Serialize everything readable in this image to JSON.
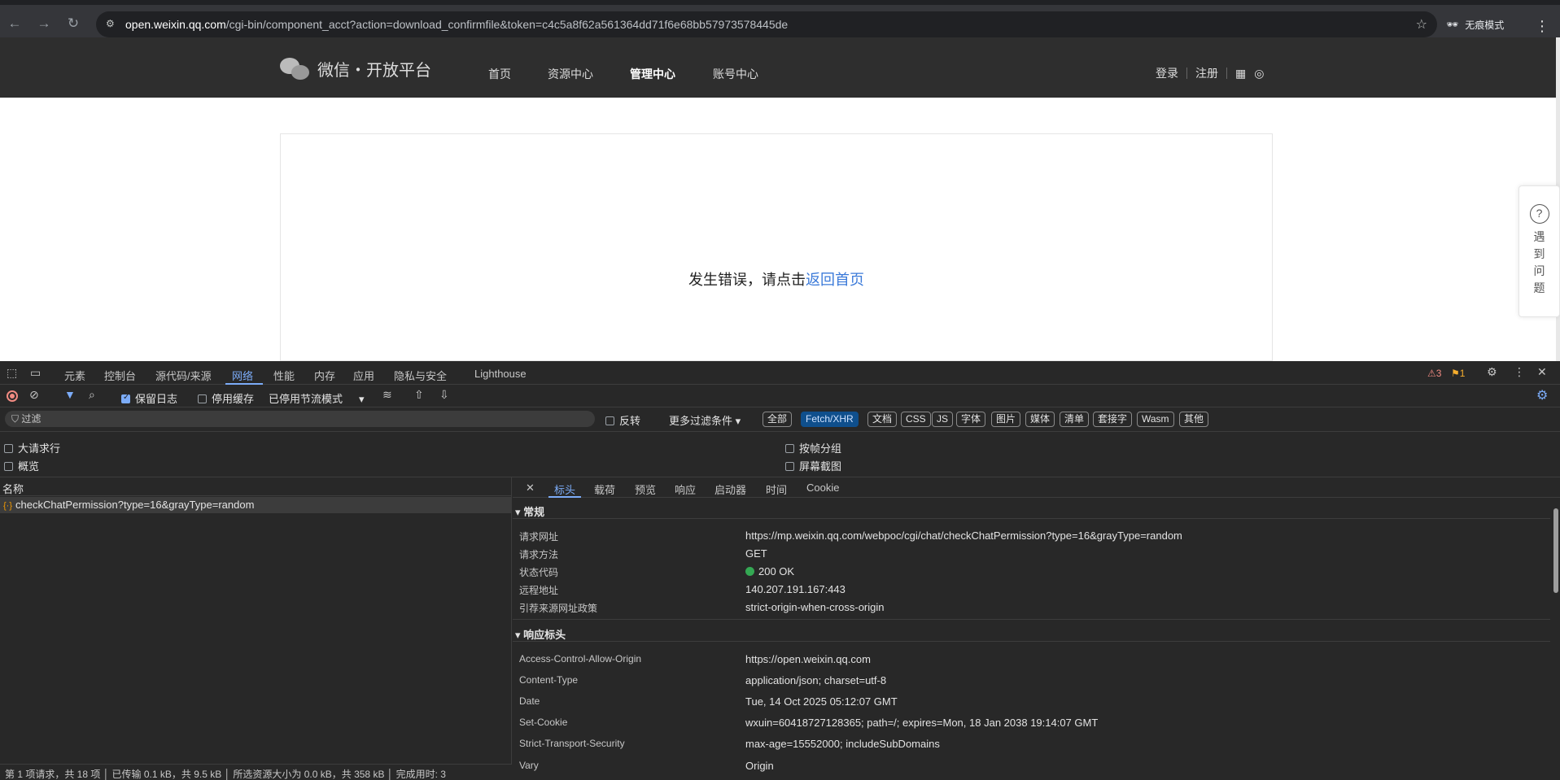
{
  "browser": {
    "url_host": "open.weixin.qq.com",
    "url_rest": "/cgi-bin/component_acct?action=download_confirmfile&token=c4c5a8f62a561364dd71f6e68bb57973578445de",
    "incognito_label": "无痕模式"
  },
  "site": {
    "logo_text": "微信・开放平台",
    "nav": [
      "首页",
      "资源中心",
      "管理中心",
      "账号中心"
    ],
    "active_nav": "管理中心",
    "login": "登录",
    "register": "注册"
  },
  "page": {
    "error_text": "发生错误，请点击",
    "error_link": "返回首页",
    "help_float": "遇到问题"
  },
  "devtools": {
    "tabs": [
      "元素",
      "控制台",
      "源代码/来源",
      "网络",
      "性能",
      "内存",
      "应用",
      "隐私与安全",
      "Lighthouse"
    ],
    "active_tab": "网络",
    "warnings": "3",
    "issues": "1",
    "toolbar": {
      "preserve_log": "保留日志",
      "disable_cache": "停用缓存",
      "throttle": "已停用节流模式"
    },
    "filter": {
      "placeholder": "过滤",
      "invert": "反转",
      "more_filters": "更多过滤条件",
      "chips": [
        "全部",
        "Fetch/XHR",
        "文档",
        "CSS",
        "JS",
        "字体",
        "图片",
        "媒体",
        "清单",
        "套接字",
        "Wasm",
        "其他"
      ],
      "selected_chip": "Fetch/XHR"
    },
    "options": {
      "big_rows": "大请求行",
      "group_by_frame": "按帧分组",
      "overview": "概览",
      "screenshots": "屏幕截图"
    },
    "name_header": "名称",
    "request_name": "checkChatPermission?type=16&grayType=random",
    "detail_tabs": [
      "标头",
      "载荷",
      "预览",
      "响应",
      "启动器",
      "时间",
      "Cookie"
    ],
    "active_detail_tab": "标头",
    "general": {
      "title": "常规",
      "rows": [
        {
          "key": "请求网址",
          "value": "https://mp.weixin.qq.com/webpoc/cgi/chat/checkChatPermission?type=16&grayType=random"
        },
        {
          "key": "请求方法",
          "value": "GET"
        },
        {
          "key": "状态代码",
          "value": "200 OK"
        },
        {
          "key": "远程地址",
          "value": "140.207.191.167:443"
        },
        {
          "key": "引荐来源网址政策",
          "value": "strict-origin-when-cross-origin"
        }
      ]
    },
    "response_headers": {
      "title": "响应标头",
      "rows": [
        {
          "key": "Access-Control-Allow-Origin",
          "value": "https://open.weixin.qq.com"
        },
        {
          "key": "Content-Type",
          "value": "application/json; charset=utf-8"
        },
        {
          "key": "Date",
          "value": "Tue, 14 Oct 2025 05:12:07 GMT"
        },
        {
          "key": "Set-Cookie",
          "value": "wxuin=60418727128365; path=/; expires=Mon, 18 Jan 2038 19:14:07 GMT"
        },
        {
          "key": "Strict-Transport-Security",
          "value": "max-age=15552000; includeSubDomains"
        },
        {
          "key": "Vary",
          "value": "Origin"
        }
      ]
    },
    "status_bar": "第 1 项请求，共 18 项 │ 已传输 0.1 kB，共 9.5 kB │ 所选资源大小为 0.0 kB，共 358 kB │ 完成用时: 3"
  }
}
